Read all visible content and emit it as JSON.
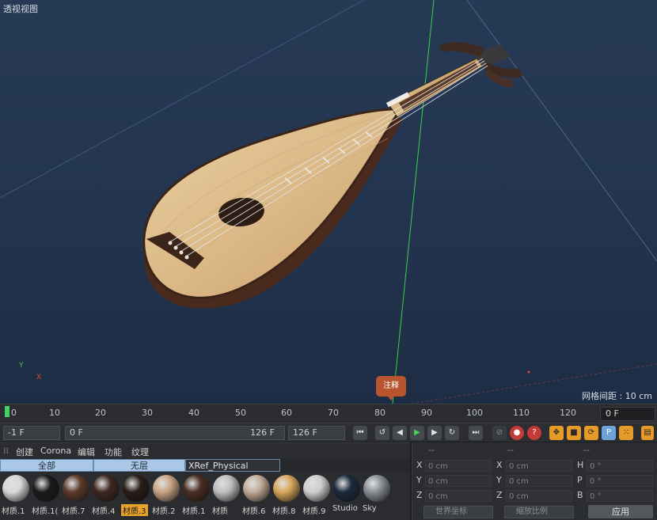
{
  "viewport": {
    "title": "透视视图",
    "grid_spacing": "网格间距 : 10 cm",
    "annotation": "注释",
    "axis_y": "Y",
    "axis_x": "X"
  },
  "timeline": {
    "ticks": [
      "0",
      "10",
      "20",
      "30",
      "40",
      "50",
      "60",
      "70",
      "80",
      "90",
      "100",
      "110",
      "120"
    ],
    "current_frame": "0 F"
  },
  "transport": {
    "start_field": "-1 F",
    "range_start": "0 F",
    "range_end": "126 F",
    "end_field": "126 F"
  },
  "material_panel": {
    "menu": [
      "创建",
      "Corona",
      "编辑",
      "功能",
      "纹理"
    ],
    "tabs": [
      "全部",
      "无层",
      "XRef_Physical Render"
    ],
    "materials": [
      {
        "label": "材质.1",
        "color": "#d8d8d8"
      },
      {
        "label": "材质.1(",
        "color": "#1a1a1a"
      },
      {
        "label": "材质.7",
        "color": "#5b3a2a"
      },
      {
        "label": "材质.4",
        "color": "#3e2820"
      },
      {
        "label": "材质.3",
        "color": "#2a1d18",
        "active": true
      },
      {
        "label": "材质.2",
        "color": "#c9a383"
      },
      {
        "label": "材质.1",
        "color": "#4a2e22"
      },
      {
        "label": "材质",
        "color": "#bfbfbf"
      },
      {
        "label": "材质.6",
        "color": "#c2ab98"
      },
      {
        "label": "材质.8",
        "color": "#d7a65a"
      },
      {
        "label": "材质.9",
        "color": "#cfcfcf"
      },
      {
        "label": "Studio",
        "color": "#1a2a3c"
      },
      {
        "label": "Sky",
        "color": "#8a8f96"
      }
    ]
  },
  "coordinates": {
    "headers": [
      "--",
      "--",
      "--"
    ],
    "rows": [
      {
        "a": "X",
        "a_val": "0 cm",
        "b": "X",
        "b_val": "0 cm",
        "c": "H",
        "c_val": "0 °"
      },
      {
        "a": "Y",
        "a_val": "0 cm",
        "b": "Y",
        "b_val": "0 cm",
        "c": "P",
        "c_val": "0 °"
      },
      {
        "a": "Z",
        "a_val": "0 cm",
        "b": "Z",
        "b_val": "0 cm",
        "c": "B",
        "c_val": "0 °"
      }
    ],
    "world_dropdown": "世界坐标",
    "scale_dropdown": "缩放比例",
    "apply": "应用"
  }
}
